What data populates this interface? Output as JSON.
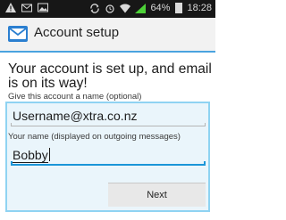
{
  "status_bar": {
    "battery_percent": "64%",
    "time": "18:28"
  },
  "action_bar": {
    "title": "Account setup",
    "icon": "email-icon"
  },
  "content": {
    "headline": "Your account is set up, and email is on its way!",
    "account_name_hint": "Give this account a name (optional)",
    "account_name_value": "Username@xtra.co.nz",
    "your_name_label": "Your name (displayed on outgoing messages)",
    "your_name_value": "Bobby"
  },
  "buttons": {
    "next_label": "Next"
  },
  "colors": {
    "accent": "#1b95d8",
    "panel_bg": "#eaf5fb",
    "panel_border": "#8fd3f2",
    "status_bar_bg": "#171717"
  }
}
